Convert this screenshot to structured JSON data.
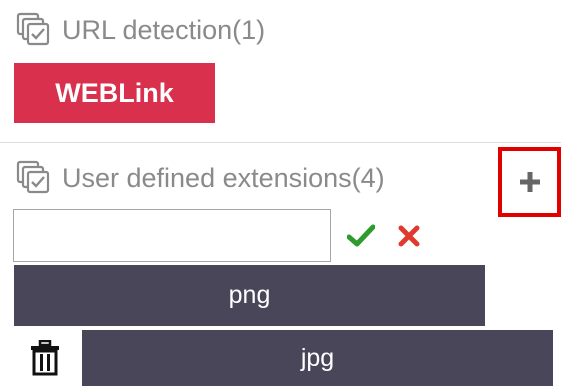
{
  "url_detection": {
    "title": "URL detection(1)",
    "icon": "checklist-icon",
    "tags": [
      "WEBLink"
    ],
    "tag_color": "#d9304d"
  },
  "user_extensions": {
    "title": "User defined extensions(4)",
    "icon": "checklist-icon",
    "add_icon": "plus-icon",
    "input_value": "",
    "confirm_icon": "check-icon",
    "cancel_icon": "x-icon",
    "delete_icon": "trash-icon",
    "extensions": [
      "png",
      "jpg"
    ],
    "tag_color": "#4a4659"
  },
  "colors": {
    "highlight_border": "#e00000",
    "confirm": "#2e9b2e",
    "cancel": "#e03a2f"
  }
}
